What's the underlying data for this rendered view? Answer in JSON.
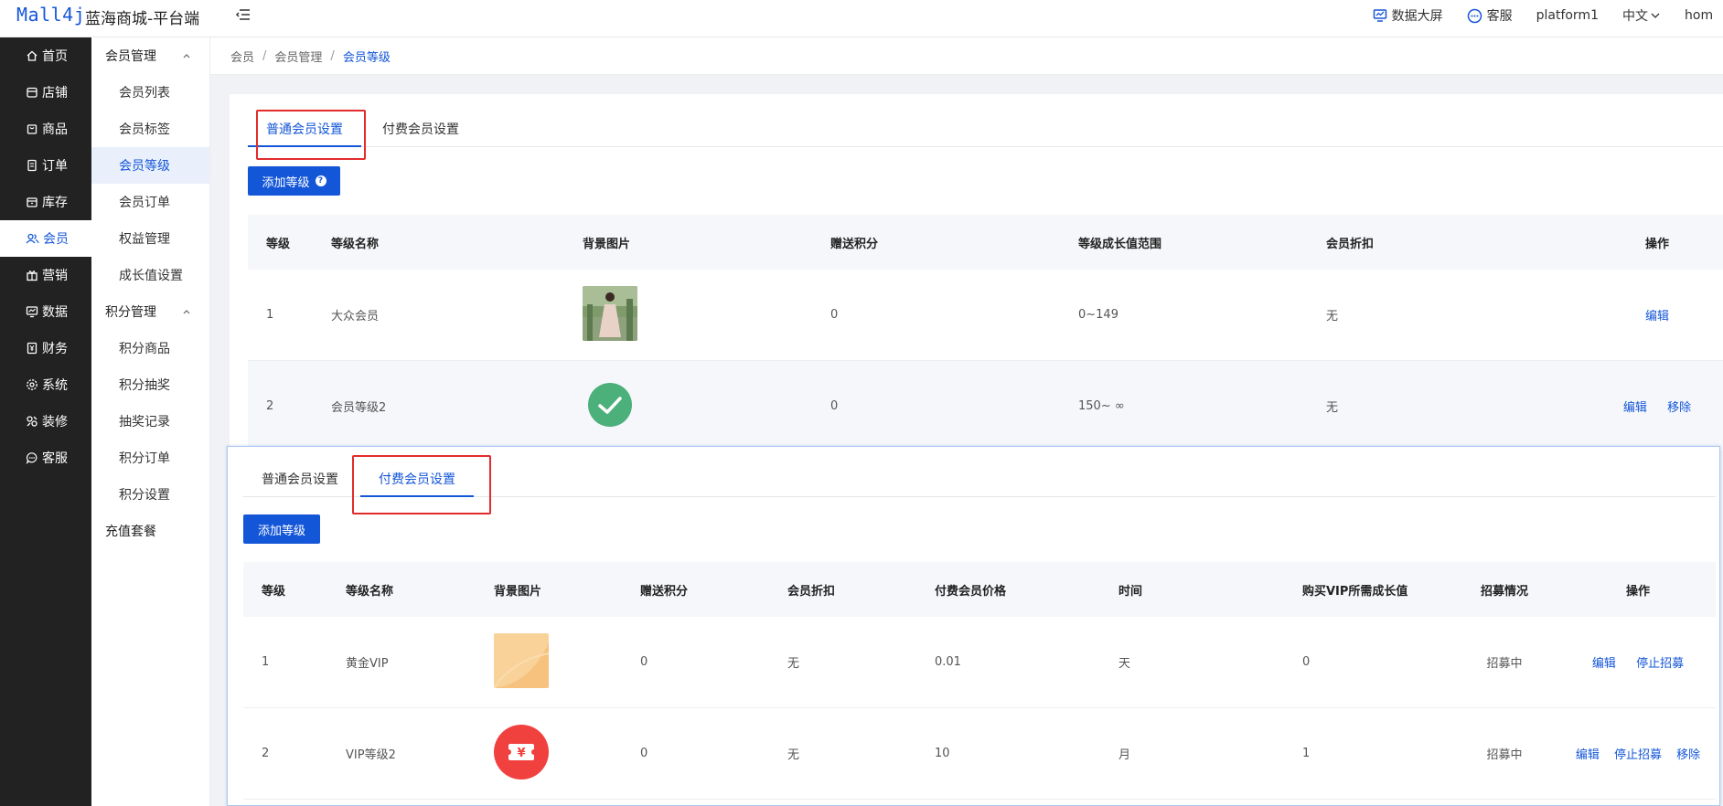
{
  "header": {
    "logo_text": "Mall4j",
    "app_title": "蓝海商城-平台端",
    "data_screen": "数据大屏",
    "customer_service": "客服",
    "platform": "platform1",
    "language": "中文",
    "user": "hom"
  },
  "primary_nav": [
    {
      "label": "首页",
      "icon": "home-icon"
    },
    {
      "label": "店铺",
      "icon": "shop-icon"
    },
    {
      "label": "商品",
      "icon": "bag-icon"
    },
    {
      "label": "订单",
      "icon": "order-icon"
    },
    {
      "label": "库存",
      "icon": "box-icon"
    },
    {
      "label": "会员",
      "icon": "members-icon",
      "active": true
    },
    {
      "label": "营销",
      "icon": "gift-icon"
    },
    {
      "label": "数据",
      "icon": "chart-icon"
    },
    {
      "label": "财务",
      "icon": "finance-icon"
    },
    {
      "label": "系统",
      "icon": "settings-icon"
    },
    {
      "label": "装修",
      "icon": "decorate-icon"
    },
    {
      "label": "客服",
      "icon": "chat-icon"
    }
  ],
  "secondary_nav": {
    "group1": "会员管理",
    "group1_items": [
      "会员列表",
      "会员标签",
      "会员等级",
      "会员订单",
      "权益管理",
      "成长值设置"
    ],
    "group2": "积分管理",
    "group2_items": [
      "积分商品",
      "积分抽奖",
      "抽奖记录",
      "积分订单",
      "积分设置"
    ],
    "recharge": "充值套餐"
  },
  "breadcrumb": [
    "会员",
    "会员管理",
    "会员等级"
  ],
  "panel_normal": {
    "tabs": [
      "普通会员设置",
      "付费会员设置"
    ],
    "add_button": "添加等级",
    "columns": [
      "等级",
      "等级名称",
      "背景图片",
      "赠送积分",
      "等级成长值范围",
      "会员折扣",
      "操作"
    ],
    "rows": [
      {
        "level": "1",
        "name": "大众会员",
        "image": "photo-thumbnail",
        "points": "0",
        "range": "0~149",
        "discount": "无",
        "actions": [
          "编辑"
        ]
      },
      {
        "level": "2",
        "name": "会员等级2",
        "image": "check-badge-icon",
        "points": "0",
        "range": "150~ ∞",
        "discount": "无",
        "actions": [
          "编辑",
          "移除"
        ]
      }
    ]
  },
  "panel_paid": {
    "tabs": [
      "普通会员设置",
      "付费会员设置"
    ],
    "add_button": "添加等级",
    "columns": [
      "等级",
      "等级名称",
      "背景图片",
      "赠送积分",
      "会员折扣",
      "付费会员价格",
      "时间",
      "购买VIP所需成长值",
      "招募情况",
      "操作"
    ],
    "rows": [
      {
        "level": "1",
        "name": "黄金VIP",
        "image": "gold-card-thumbnail",
        "points": "0",
        "discount": "无",
        "price": "0.01",
        "time": "天",
        "growth": "0",
        "status": "招募中",
        "actions": [
          "编辑",
          "停止招募"
        ]
      },
      {
        "level": "2",
        "name": "VIP等级2",
        "image": "coupon-badge-icon",
        "points": "0",
        "discount": "无",
        "price": "10",
        "time": "月",
        "growth": "1",
        "status": "招募中",
        "actions": [
          "编辑",
          "停止招募",
          "移除"
        ]
      }
    ]
  },
  "colors": {
    "brand": "#1456d8",
    "sidebar": "#222222",
    "highlight_box": "#e32b2b",
    "check_badge": "#4cb07a",
    "coupon_badge": "#f0413f"
  }
}
